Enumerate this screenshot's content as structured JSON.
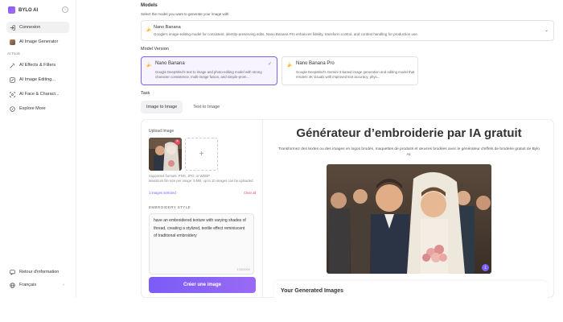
{
  "brand": {
    "name": "BYLO AI"
  },
  "sidebar": {
    "collapse_icon": "collapse-icon",
    "items": [
      {
        "label": "Connexion",
        "icon": "login-icon"
      },
      {
        "label": "AI Image Generator",
        "icon": "avatar-thumbnail"
      },
      {
        "label": "AI Effects & Filters",
        "icon": "effects-icon"
      },
      {
        "label": "AI Image Editing...",
        "icon": "edit-icon"
      },
      {
        "label": "AI Face & Charact...",
        "icon": "face-icon"
      },
      {
        "label": "Explore More",
        "icon": "compass-icon"
      }
    ],
    "section_label": "AI Tools",
    "footer": [
      {
        "label": "Retour d'information",
        "icon": "feedback-icon"
      },
      {
        "label": "Français",
        "icon": "globe-icon"
      }
    ]
  },
  "models": {
    "heading": "Models",
    "subheading": "Select the model you want to generate your image with",
    "selected": {
      "title": "Nano Banana",
      "description": "Google's image-editing model for consistent, identity-preserving edits. Nano Banana Pro enhances fidelity, transform control, and context handling for production use."
    }
  },
  "model_version": {
    "heading": "Model Version",
    "options": [
      {
        "title": "Nano Banana",
        "description": "Google DeepMind's text to image and photo-editing model with strong character consistence, multi-image fusion, and simple-prom..."
      },
      {
        "title": "Nano Banana Pro",
        "description": "Google DeepMind's Gemini-3-based image generation and editing model that renders 4K visuals with improved text accuracy, phys..."
      }
    ]
  },
  "task": {
    "heading": "Task",
    "tabs": [
      "Image to Image",
      "Text to Image"
    ]
  },
  "upload": {
    "title": "Upload Image",
    "formats": "Supported formats: PNG, JPG, or WEBP\nMaximum file size per image: 5 MB, up to 10 images can be uploaded",
    "selected_count": "1 images selected",
    "clear": "Clear all"
  },
  "style": {
    "label": "EMBROIDERY STYLE",
    "text": "have an embroidered texture with varying shades of thread, creating a stylized, textile effect reminiscent of traditional embroidery",
    "char_count": "133/2000"
  },
  "create_button": "Créer une image",
  "hero": {
    "title": "Générateur d’embroiderie par IA gratuit",
    "description": "Transformez des textes ou des images en logos brodés, maquettes de produits et œuvres brodées avec le générateur d'effets de broderie gratuit de Bylo AI."
  },
  "generated": {
    "title": "Your Generated Images"
  },
  "colors": {
    "accent": "#7b61ff",
    "danger": "#e64b6a"
  }
}
